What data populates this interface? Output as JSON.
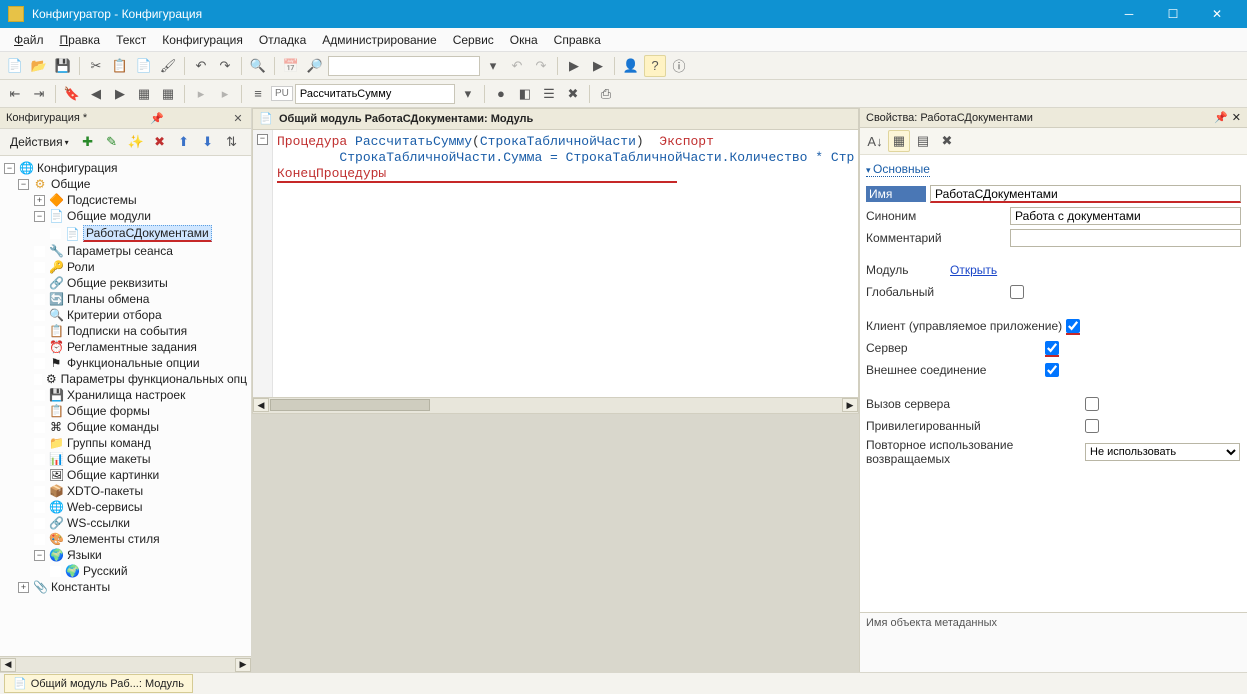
{
  "window": {
    "title": "Конфигуратор - Конфигурация"
  },
  "menu": {
    "file": "Файл",
    "edit": "Правка",
    "text": "Текст",
    "config": "Конфигурация",
    "debug": "Отладка",
    "admin": "Администрирование",
    "service": "Сервис",
    "windows": "Окна",
    "help": "Справка"
  },
  "toolbar2": {
    "proc_combo": "РассчитатьСумму"
  },
  "left_panel": {
    "title": "Конфигурация *",
    "actions_label": "Действия",
    "tree": {
      "root": "Конфигурация",
      "common": "Общие",
      "items": [
        "Подсистемы",
        "Общие модули",
        "Параметры сеанса",
        "Роли",
        "Общие реквизиты",
        "Планы обмена",
        "Критерии отбора",
        "Подписки на события",
        "Регламентные задания",
        "Функциональные опции",
        "Параметры функциональных опц",
        "Хранилища настроек",
        "Общие формы",
        "Общие команды",
        "Группы команд",
        "Общие макеты",
        "Общие картинки",
        "XDTO-пакеты",
        "Web-сервисы",
        "WS-ссылки",
        "Элементы стиля",
        "Языки"
      ],
      "module_selected": "РаботаСДокументами",
      "lang_child": "Русский",
      "constants": "Константы"
    }
  },
  "editor": {
    "title": "Общий модуль РаботаСДокументами: Модуль",
    "code": {
      "l1_kw1": "Процедура ",
      "l1_name": "РассчитатьСумму",
      "l1_paren_open": "(",
      "l1_arg": "СтрокаТабличнойЧасти",
      "l1_paren_close": ")  ",
      "l1_kw2": "Экспорт",
      "l2": "        СтрокаТабличнойЧасти.Сумма = СтрокаТабличнойЧасти.Количество * Стр",
      "l3": "КонецПроцедуры"
    }
  },
  "props": {
    "title": "Свойства: РаботаСДокументами",
    "section_main": "Основные",
    "name_label": "Имя",
    "name_value": "РаботаСДокументами",
    "synonym_label": "Синоним",
    "synonym_value": "Работа с документами",
    "comment_label": "Комментарий",
    "comment_value": "",
    "module_label": "Модуль",
    "module_link": "Открыть",
    "global_label": "Глобальный",
    "client_managed_label": "Клиент (управляемое приложение)",
    "server_label": "Сервер",
    "external_conn_label": "Внешнее соединение",
    "server_call_label": "Вызов сервера",
    "privileged_label": "Привилегированный",
    "reuse_label": "Повторное использование возвращаемых",
    "reuse_value": "Не использовать",
    "help_text": "Имя объекта метаданных"
  },
  "status": {
    "tab": "Общий модуль Раб...: Модуль"
  }
}
